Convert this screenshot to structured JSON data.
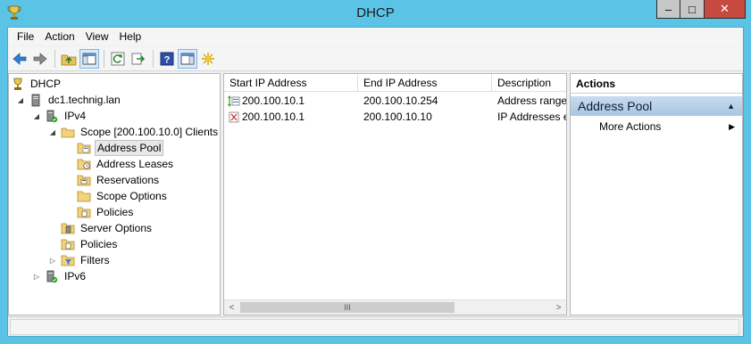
{
  "window": {
    "title": "DHCP",
    "controls": {
      "minimize": "–",
      "maximize": "□",
      "close": "✕"
    }
  },
  "menu": [
    "File",
    "Action",
    "View",
    "Help"
  ],
  "toolbar": [
    "back-arrow-icon",
    "forward-arrow-icon",
    "up-folder-icon",
    "show-hide-console-tree-icon",
    "refresh-icon",
    "export-list-icon",
    "help-icon",
    "show-hide-action-pane-icon",
    "new-star-icon"
  ],
  "tree": {
    "root": "DHCP",
    "server": "dc1.technig.lan",
    "ipv4": "IPv4",
    "scope": "Scope [200.100.10.0] Clients",
    "address_pool": "Address Pool",
    "address_leases": "Address Leases",
    "reservations": "Reservations",
    "scope_options": "Scope Options",
    "scope_policies": "Policies",
    "server_options": "Server Options",
    "policies": "Policies",
    "filters": "Filters",
    "ipv6": "IPv6"
  },
  "list": {
    "columns": [
      "Start IP Address",
      "End IP Address",
      "Description"
    ],
    "rows": [
      {
        "start": "200.100.10.1",
        "end": "200.100.10.254",
        "description": "Address range",
        "icon": "address-range-icon"
      },
      {
        "start": "200.100.10.1",
        "end": "200.100.10.10",
        "description": "IP Addresses e",
        "icon": "exclusion-range-icon"
      }
    ],
    "scroll_thumb": "III"
  },
  "actions": {
    "title": "Actions",
    "group": "Address Pool",
    "items": [
      "More Actions"
    ]
  },
  "colors": {
    "titlebar": "#5bc4e6",
    "close_button": "#c74a40",
    "actions_group": "#b7cfe9"
  }
}
